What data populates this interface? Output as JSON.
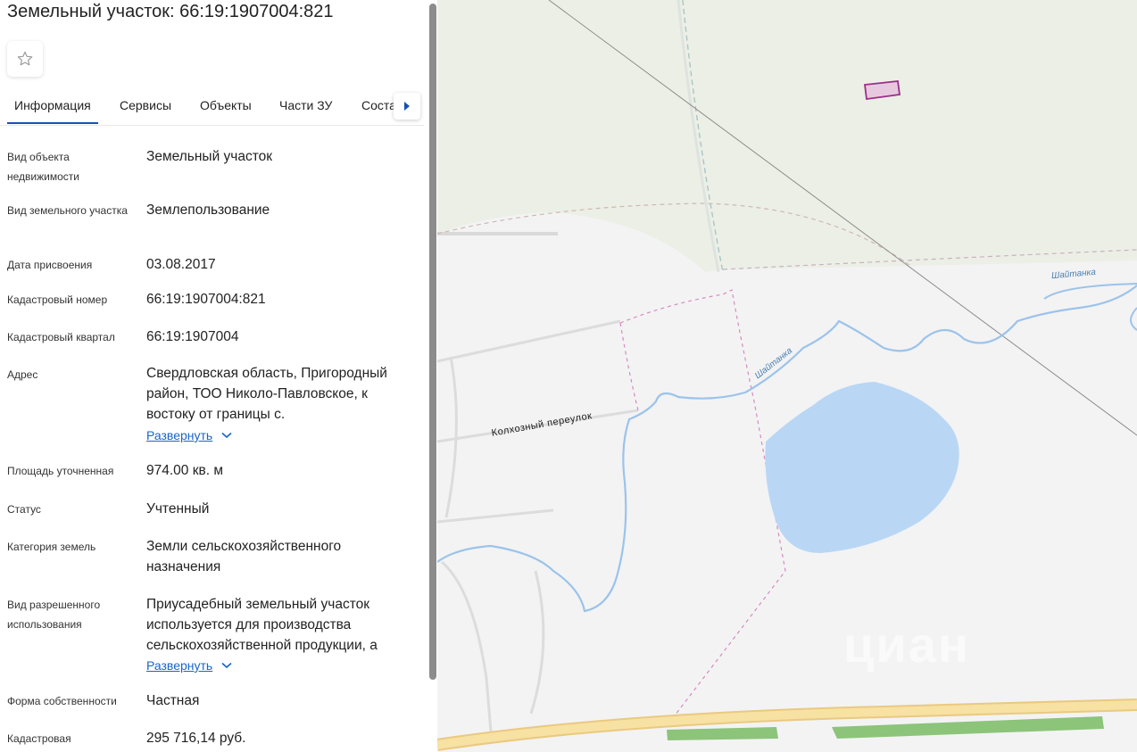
{
  "title": "Земельный участок: 66:19:1907004:821",
  "icons": {
    "favorite": "star-icon",
    "tab_next": "chevron-right-icon",
    "expand": "chevron-down-icon"
  },
  "tabs": [
    {
      "label": "Информация",
      "active": true
    },
    {
      "label": "Сервисы"
    },
    {
      "label": "Объекты"
    },
    {
      "label": "Части ЗУ"
    },
    {
      "label": "Соста"
    }
  ],
  "fields": [
    {
      "label": "Вид объекта недвижимости",
      "value": "Земельный участок"
    },
    {
      "label": "Вид земельного участка",
      "value": "Землепользование"
    },
    {
      "label": "Дата присвоения",
      "value": "03.08.2017"
    },
    {
      "label": "Кадастровый номер",
      "value": "66:19:1907004:821"
    },
    {
      "label": "Кадастровый квартал",
      "value": "66:19:1907004"
    },
    {
      "label": "Адрес",
      "value": "Свердловская область, Пригородный район, ТОО Николо-Павловское, к востоку от границы с.",
      "expand": "Развернуть"
    },
    {
      "label": "Площадь уточненная",
      "value": "974.00 кв. м"
    },
    {
      "label": "Статус",
      "value": "Учтенный"
    },
    {
      "label": "Категория земель",
      "value": "Земли сельскохозяйственного назначения"
    },
    {
      "label": "Вид разрешенного использования",
      "value": "Приусадебный земельный участок используется для производства сельскохозяйственной продукции, а",
      "expand": "Развернуть"
    },
    {
      "label": "Форма собственности",
      "value": "Частная"
    },
    {
      "label": "Кадастровая",
      "value": "295 716,14 руб."
    }
  ],
  "map": {
    "street_label": "Колхозный переулок",
    "river_labels": [
      "Шайтанка",
      "Шайтанка"
    ],
    "watermark": "циан",
    "colors": {
      "background": "#f3f3f4",
      "field": "#ecefe6",
      "water": "#b9d7f5",
      "river": "#9cc3ea",
      "road": "#f5dc8a",
      "green": "#8cc47a",
      "parcel": "#9b2f8a"
    }
  }
}
